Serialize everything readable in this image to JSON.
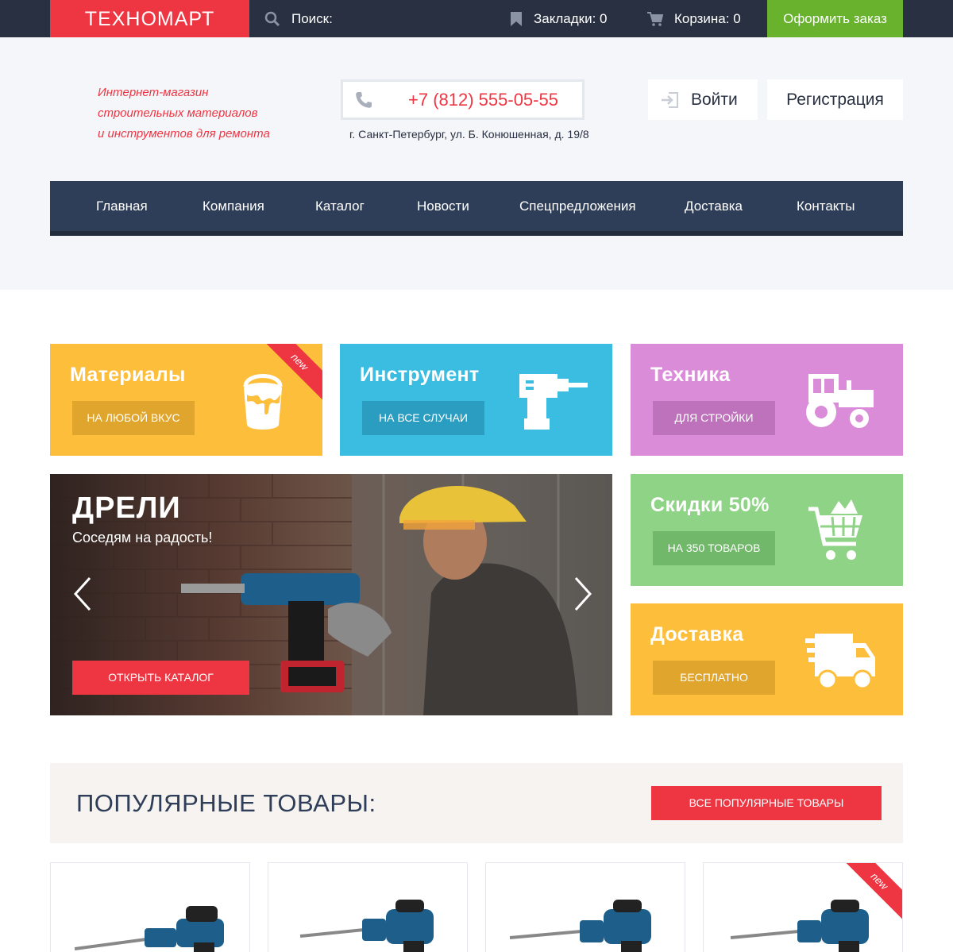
{
  "topbar": {
    "logo": "ТЕХНОМАРТ",
    "search_label": "Поиск:",
    "bookmarks_label": "Закладки: 0",
    "cart_label": "Корзина: 0",
    "checkout_label": "Оформить заказ"
  },
  "header": {
    "tagline_line1": "Интернет-магазин",
    "tagline_line2": "строительных материалов",
    "tagline_line3": "и инструментов для ремонта",
    "phone": "+7 (812) 555-05-55",
    "address": "г. Санкт-Петербург, ул. Б. Конюшенная, д. 19/8",
    "login_label": "Войти",
    "register_label": "Регистрация"
  },
  "nav": {
    "items": [
      "Главная",
      "Компания",
      "Каталог",
      "Новости",
      "Спецпредложения",
      "Доставка",
      "Контакты"
    ]
  },
  "tiles": {
    "materials": {
      "title": "Материалы",
      "button": "НА ЛЮБОЙ ВКУС",
      "ribbon": "new"
    },
    "tools": {
      "title": "Инструмент",
      "button": "НА ВСЕ СЛУЧАИ"
    },
    "tech": {
      "title": "Техника",
      "button": "ДЛЯ СТРОЙКИ"
    },
    "sale": {
      "title": "Скидки 50%",
      "button": "НА 350 ТОВАРОВ"
    },
    "delivery": {
      "title": "Доставка",
      "button": "БЕСПЛАТНО"
    }
  },
  "slider": {
    "title": "ДРЕЛИ",
    "subtitle": "Соседям на радость!",
    "button": "ОТКРЫТЬ КАТАЛОГ"
  },
  "popular": {
    "title": "ПОПУЛЯРНЫЕ ТОВАРЫ:",
    "button": "ВСЕ ПОПУЛЯРНЫЕ ТОВАРЫ",
    "card_ribbon": "new"
  },
  "colors": {
    "brand_red": "#ee3643",
    "dark_navy": "#283041",
    "nav_blue": "#2f3e58",
    "green": "#68b22e",
    "yellow": "#fdbe3b",
    "cyan": "#3bbde1",
    "purple": "#db8cd8",
    "light_green": "#8ed386"
  },
  "icons": {
    "search": "search-icon",
    "bookmark": "bookmark-icon",
    "cart": "cart-icon",
    "phone": "phone-icon",
    "login": "login-icon",
    "paint_bucket": "paint-bucket-icon",
    "drill": "drill-icon",
    "tractor": "tractor-icon",
    "shopping_cart": "shopping-cart-icon",
    "truck": "delivery-truck-icon",
    "arrow_left": "chevron-left-icon",
    "arrow_right": "chevron-right-icon"
  }
}
